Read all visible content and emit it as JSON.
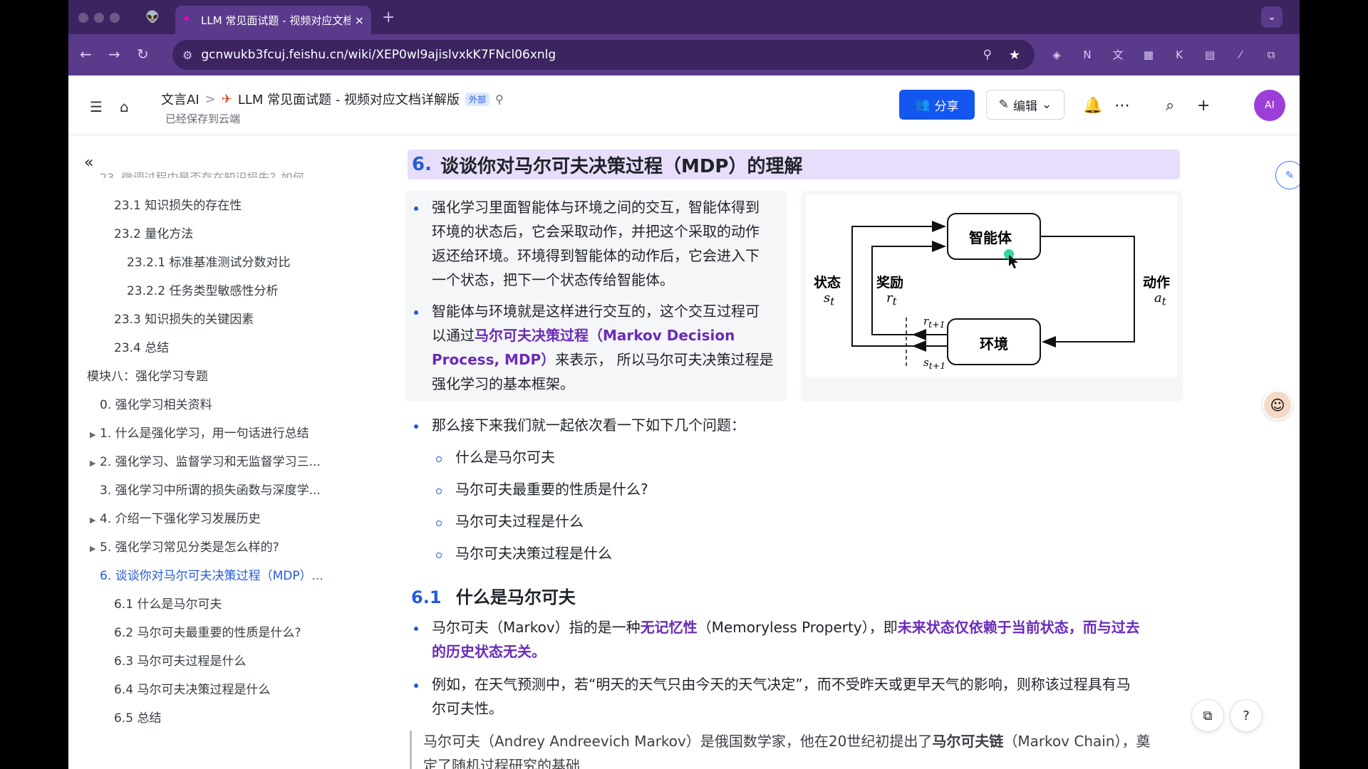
{
  "browser": {
    "tab_title": "LLM 常见面试题 - 视频对应文档",
    "tab_close": "×",
    "new_tab": "+",
    "tab_menu": "⌄",
    "url": "gcnwukb3fcuj.feishu.cn/wiki/XEP0wl9ajislvxkK7FNcl06xnlg"
  },
  "header": {
    "breadcrumb_root": "文言AI",
    "breadcrumb_sep": ">",
    "doc_title": "LLM 常见面试题 - 视频对应文档详解版",
    "external_badge": "外部",
    "saved_status": "已经保存到云端",
    "share_label": "分享",
    "edit_label": "编辑",
    "avatar_initials": "AI"
  },
  "sidebar": {
    "items": [
      {
        "label": "23.1 知识损失的存在性"
      },
      {
        "label": "23.2 量化方法"
      },
      {
        "label": "23.2.1 标准基准测试分数对比"
      },
      {
        "label": "23.2.2 任务类型敏感性分析"
      },
      {
        "label": "23.3 知识损失的关键因素"
      },
      {
        "label": "23.4 总结"
      },
      {
        "label": "模块八：强化学习专题"
      },
      {
        "label": "0. 强化学习相关资料"
      },
      {
        "label": "1. 什么是强化学习，用一句话进行总结"
      },
      {
        "label": "2. 强化学习、监督学习和无监督学习三..."
      },
      {
        "label": "3. 强化学习中所谓的损失函数与深度学..."
      },
      {
        "label": "4. 介绍一下强化学习发展历史"
      },
      {
        "label": "5. 强化学习常见分类是怎么样的?"
      },
      {
        "label": "6. 谈谈你对马尔可夫决策过程（MDP）..."
      },
      {
        "label": "6.1 什么是马尔可夫"
      },
      {
        "label": "6.2 马尔可夫最重要的性质是什么?"
      },
      {
        "label": "6.3 马尔可夫过程是什么"
      },
      {
        "label": "6.4 马尔可夫决策过程是什么"
      },
      {
        "label": "6.5 总结"
      }
    ]
  },
  "doc": {
    "h6_num": "6.",
    "h6_text": "谈谈你对马尔可夫决策过程（MDP）的理解",
    "p1_lines": [
      "强化学习里面智能体与环境之间的交互，智能体得到",
      "环境的状态后，它会采取动作，并把这个采取的动作",
      "返还给环境。环境得到智能体的动作后，它会进入下",
      "一个状态，把下一个状态传给智能体。"
    ],
    "p2_line1": "智能体与环境就是这样进行交互的，这个交互过程可",
    "p2_line2_pre": "以通过",
    "p2_line2_hl": "马尔可夫决策过程（Markov Decision",
    "p2_line3_hl": "Process, MDP）",
    "p2_line3_post": "来表示，  所以马尔可夫决策过程是",
    "p2_line4": "强化学习的基本框架。",
    "p3": "那么接下来我们就一起依次看一下如下几个问题：",
    "subitems": [
      "什么是马尔可夫",
      "马尔可夫最重要的性质是什么?",
      "马尔可夫过程是什么",
      "马尔可夫决策过程是什么"
    ],
    "h61_num": "6.1",
    "h61_text": "什么是马尔可夫",
    "m1_pre": "马尔可夫（Markov）指的是一种",
    "m1_hl1": "无记忆性",
    "m1_mid": "（Memoryless Property），即",
    "m1_hl2": "未来状态仅依赖于当前状态，而与过去",
    "m1_hl3": "的历史状态无关",
    "m1_end": "。",
    "m2_line1": "例如，在天气预测中，若“明天的天气只由今天的天气决定”，而不受昨天或更早天气的影响，则称该过程具有马",
    "m2_line2": "尔可夫性。",
    "q1_pre": "马尔可夫（Andrey Andreevich Markov）是俄国数学家，他在20世纪初提出了",
    "q1_b": "马尔可夫链",
    "q1_post": "（Markov Chain），奠",
    "q2": "定了随机过程研究的基础"
  },
  "diagram": {
    "agent": "智能体",
    "env": "环境",
    "state": "状态",
    "state_sym": "s",
    "state_sub": "t",
    "reward": "奖励",
    "reward_sym": "r",
    "reward_sub": "t",
    "action": "动作",
    "action_sym": "a",
    "action_sub": "t",
    "r_next_sym": "r",
    "r_next_sub": "t+1",
    "s_next_sym": "s",
    "s_next_sub": "t+1"
  },
  "colors": {
    "accent": "#245bdb",
    "highlight": "#6a2bb8",
    "browser_dark": "#3b2460",
    "browser_mid": "#5a3a8a",
    "share": "#1456f0"
  }
}
